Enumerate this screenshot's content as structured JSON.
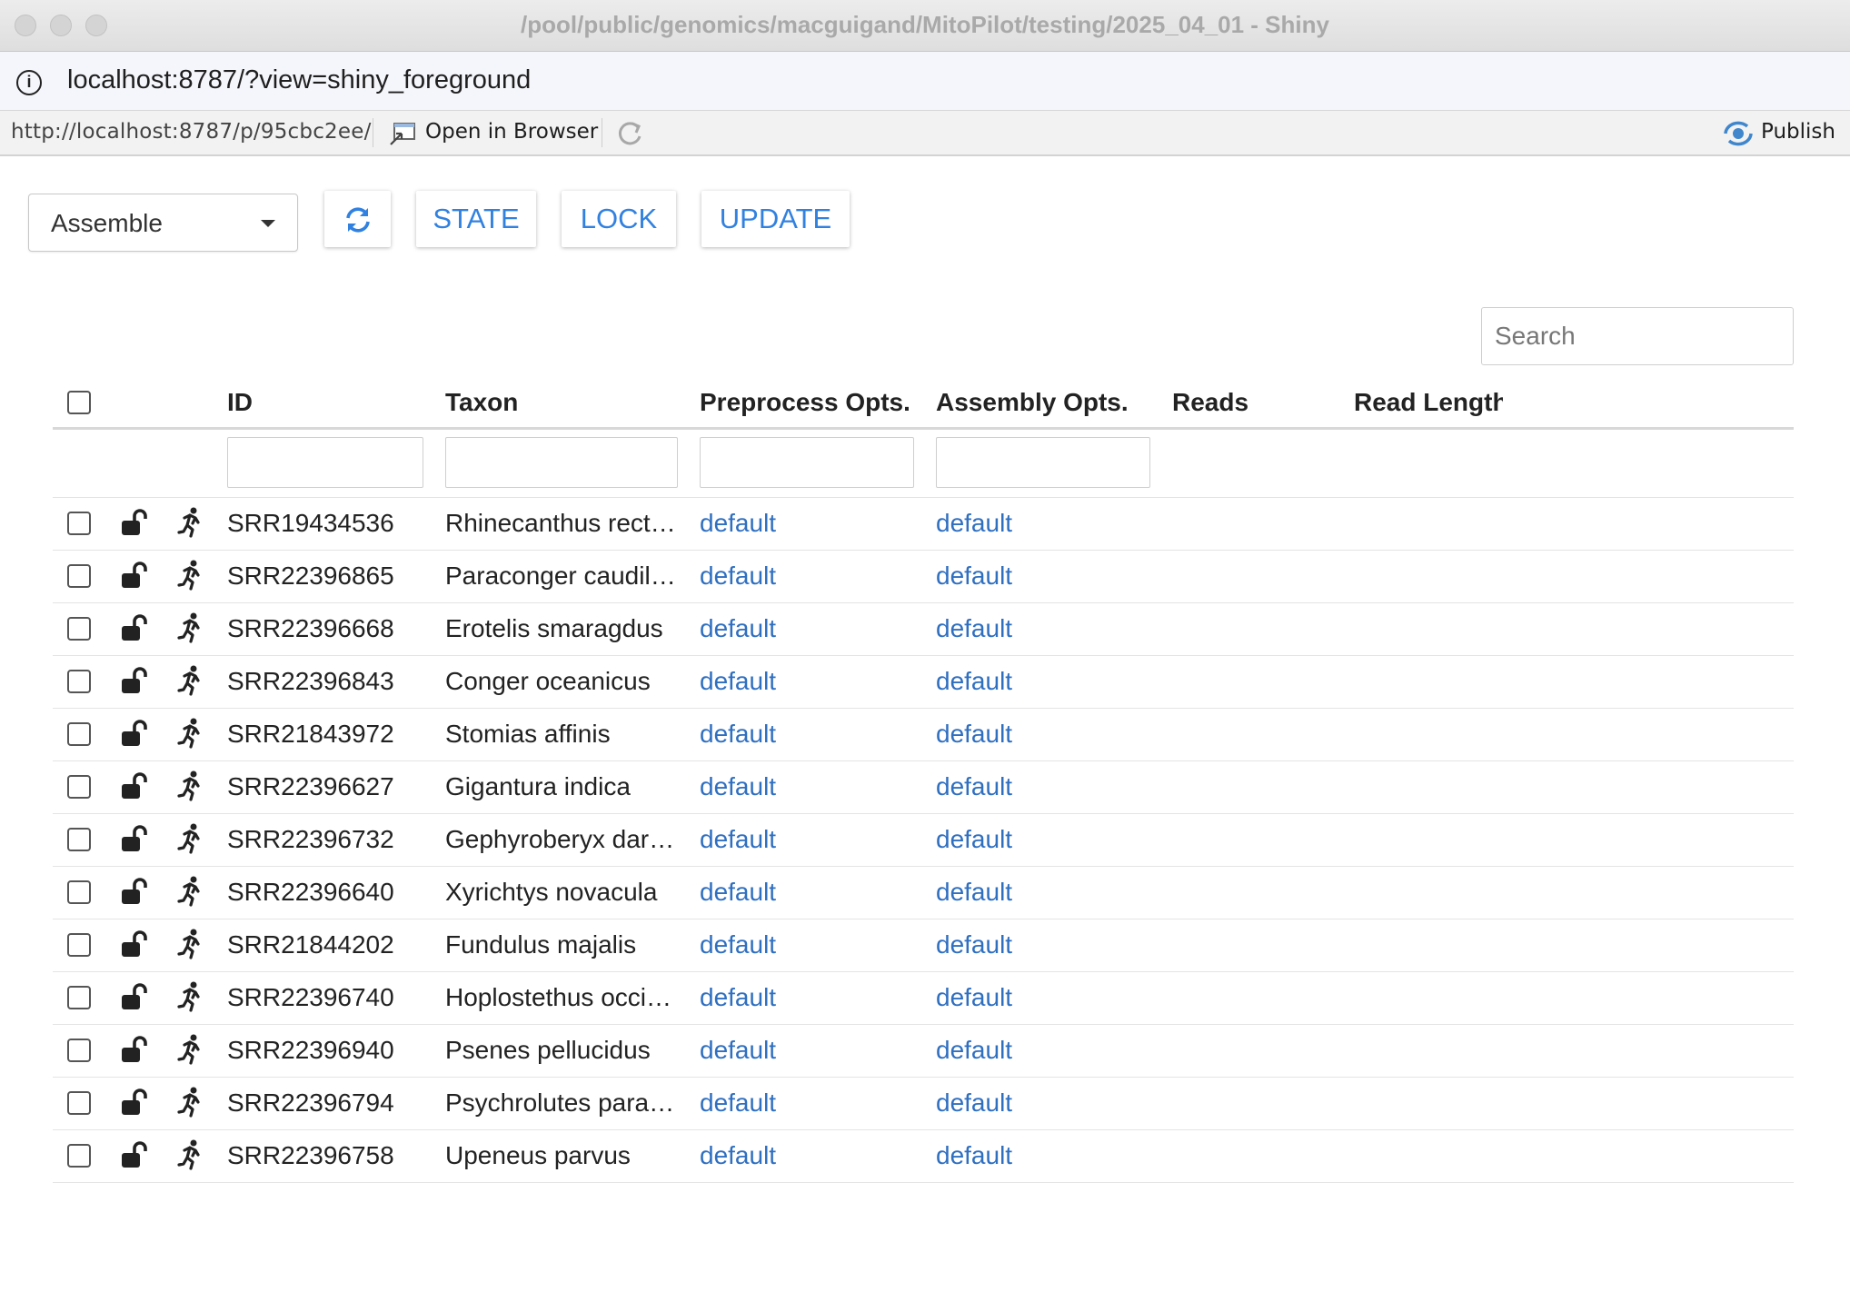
{
  "window": {
    "title": "/pool/public/genomics/macguigand/MitoPilot/testing/2025_04_01 - Shiny",
    "address": "localhost:8787/?view=shiny_foreground"
  },
  "viewer": {
    "url": "http://localhost:8787/p/95cbc2ee/",
    "open_in_browser": "Open in Browser",
    "publish": "Publish"
  },
  "toolbar": {
    "mode_select": "Assemble",
    "state_label": "STATE",
    "lock_label": "LOCK",
    "update_label": "UPDATE",
    "search_placeholder": "Search"
  },
  "colors": {
    "accent": "#3181e0",
    "link": "#2f6fc0"
  },
  "icons": {
    "row_lock": "lock-open-icon",
    "row_run": "running-person-icon",
    "refresh": "refresh-icon"
  },
  "table": {
    "headers": {
      "id": "ID",
      "taxon": "Taxon",
      "preprocess": "Preprocess Opts.",
      "assembly": "Assembly Opts.",
      "reads": "Reads",
      "read_length": "Read Length"
    },
    "rows": [
      {
        "id": "SRR19434536",
        "taxon": "Rhinecanthus rect…",
        "preprocess": "default",
        "assembly": "default"
      },
      {
        "id": "SRR22396865",
        "taxon": "Paraconger caudil…",
        "preprocess": "default",
        "assembly": "default"
      },
      {
        "id": "SRR22396668",
        "taxon": "Erotelis smaragdus",
        "preprocess": "default",
        "assembly": "default"
      },
      {
        "id": "SRR22396843",
        "taxon": "Conger oceanicus",
        "preprocess": "default",
        "assembly": "default"
      },
      {
        "id": "SRR21843972",
        "taxon": "Stomias affinis",
        "preprocess": "default",
        "assembly": "default"
      },
      {
        "id": "SRR22396627",
        "taxon": "Gigantura indica",
        "preprocess": "default",
        "assembly": "default"
      },
      {
        "id": "SRR22396732",
        "taxon": "Gephyroberyx dar…",
        "preprocess": "default",
        "assembly": "default"
      },
      {
        "id": "SRR22396640",
        "taxon": "Xyrichtys novacula",
        "preprocess": "default",
        "assembly": "default"
      },
      {
        "id": "SRR21844202",
        "taxon": "Fundulus majalis",
        "preprocess": "default",
        "assembly": "default"
      },
      {
        "id": "SRR22396740",
        "taxon": "Hoplostethus occi…",
        "preprocess": "default",
        "assembly": "default"
      },
      {
        "id": "SRR22396940",
        "taxon": "Psenes pellucidus",
        "preprocess": "default",
        "assembly": "default"
      },
      {
        "id": "SRR22396794",
        "taxon": "Psychrolutes para…",
        "preprocess": "default",
        "assembly": "default"
      },
      {
        "id": "SRR22396758",
        "taxon": "Upeneus parvus",
        "preprocess": "default",
        "assembly": "default"
      }
    ]
  }
}
